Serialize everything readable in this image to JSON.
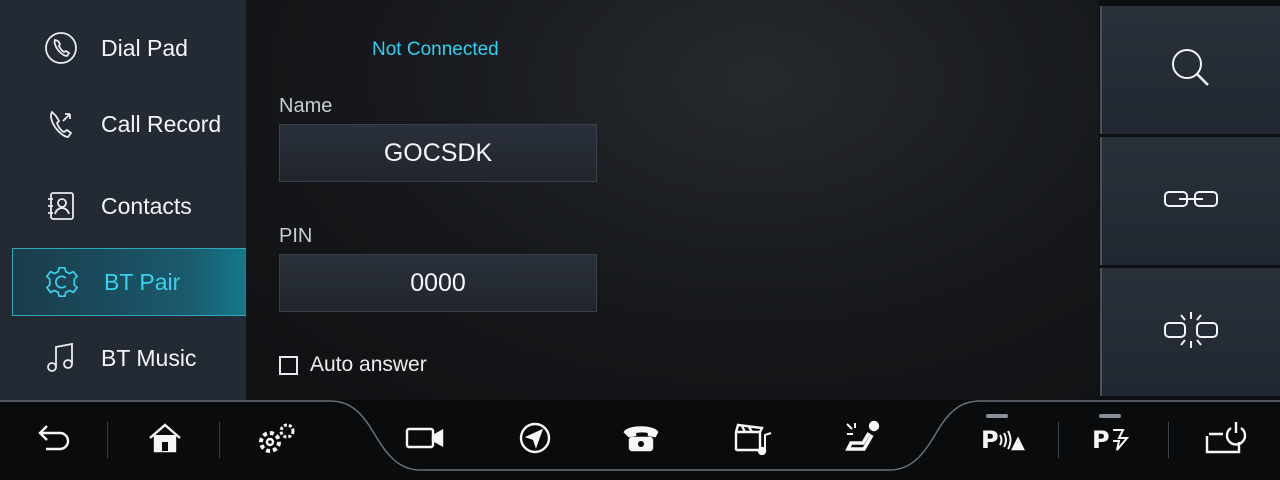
{
  "sidebar": {
    "items": [
      {
        "label": "Dial Pad",
        "icon": "phone-icon"
      },
      {
        "label": "Call Record",
        "icon": "call-record-icon"
      },
      {
        "label": "Contacts",
        "icon": "contacts-icon"
      },
      {
        "label": "BT Pair",
        "icon": "settings-gear-icon",
        "active": true
      },
      {
        "label": "BT Music",
        "icon": "music-note-icon"
      }
    ]
  },
  "main": {
    "status": "Not Connected",
    "name_label": "Name",
    "name_value": "GOCSDK",
    "pin_label": "PIN",
    "pin_value": "0000",
    "auto_answer_label": "Auto answer",
    "auto_answer_checked": false
  },
  "actions": [
    "search-icon",
    "connect-link-icon",
    "disconnect-link-icon"
  ],
  "bottombar": [
    "back-icon",
    "home-icon",
    "settings-icon",
    "camera-icon",
    "navigation-icon",
    "phone-icon",
    "media-icon",
    "seat-icon",
    "parking-sensor-icon",
    "parking-assist-icon",
    "power-icon"
  ],
  "colors": {
    "accent": "#39d2ef",
    "sidebar_bg": "#232a33",
    "active_border": "#2ea7bd"
  }
}
